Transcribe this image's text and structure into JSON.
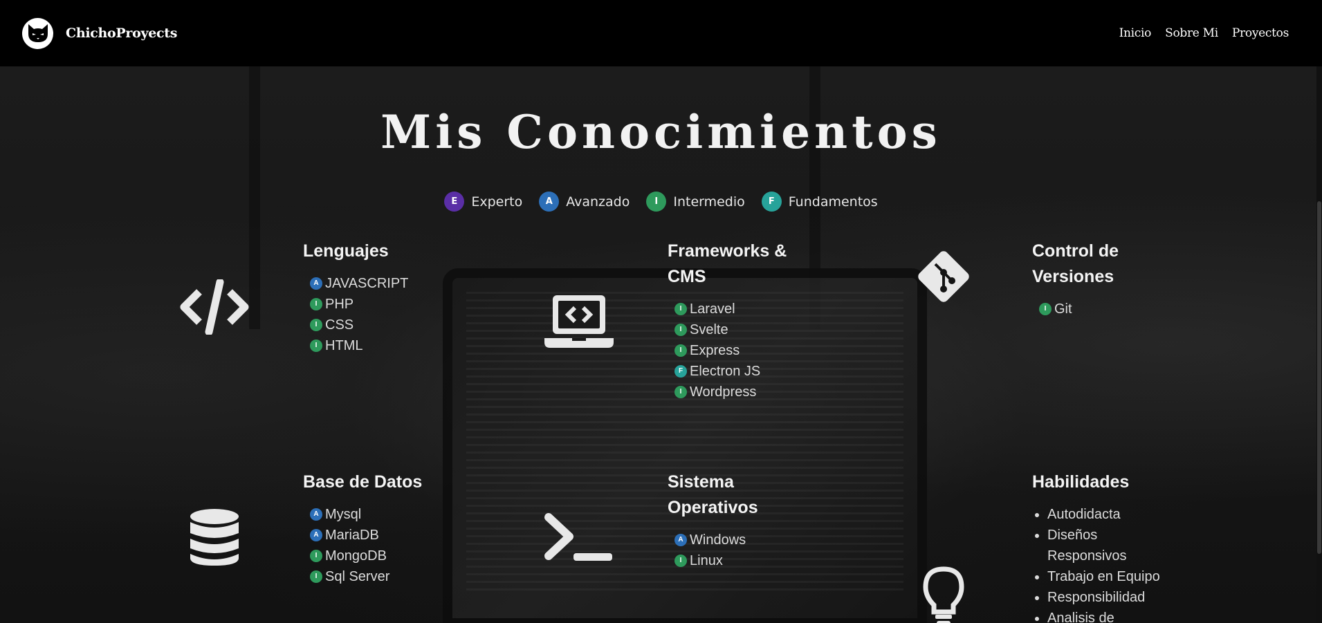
{
  "header": {
    "brand": "ChichoProyects",
    "nav": [
      "Inicio",
      "Sobre Mi",
      "Proyectos"
    ]
  },
  "title": "Mis Conocimientos",
  "legend": [
    {
      "code": "E",
      "label": "Experto",
      "color": "#5a2ea6"
    },
    {
      "code": "A",
      "label": "Avanzado",
      "color": "#2c6fb8"
    },
    {
      "code": "I",
      "label": "Intermedio",
      "color": "#2e9a5c"
    },
    {
      "code": "F",
      "label": "Fundamentos",
      "color": "#27a39a"
    }
  ],
  "categories": {
    "lenguajes": {
      "title": "Lenguajes",
      "icon": "code-icon",
      "items": [
        {
          "level": "A",
          "name": "JAVASCRIPT"
        },
        {
          "level": "I",
          "name": "PHP"
        },
        {
          "level": "I",
          "name": "CSS"
        },
        {
          "level": "I",
          "name": "HTML"
        }
      ]
    },
    "frameworks": {
      "title": "Frameworks & CMS",
      "icon": "laptop-code-icon",
      "items": [
        {
          "level": "I",
          "name": "Laravel"
        },
        {
          "level": "I",
          "name": "Svelte"
        },
        {
          "level": "I",
          "name": "Express"
        },
        {
          "level": "F",
          "name": "Electron JS"
        },
        {
          "level": "I",
          "name": "Wordpress"
        }
      ]
    },
    "versiones": {
      "title": "Control de Versiones",
      "icon": "git-icon",
      "items": [
        {
          "level": "I",
          "name": "Git"
        }
      ]
    },
    "basedatos": {
      "title": "Base de Datos",
      "icon": "database-icon",
      "items": [
        {
          "level": "A",
          "name": "Mysql"
        },
        {
          "level": "A",
          "name": "MariaDB"
        },
        {
          "level": "I",
          "name": "MongoDB"
        },
        {
          "level": "I",
          "name": "Sql Server"
        }
      ]
    },
    "sistemas": {
      "title": "Sistema Operativos",
      "icon": "terminal-icon",
      "items": [
        {
          "level": "A",
          "name": "Windows"
        },
        {
          "level": "I",
          "name": "Linux"
        }
      ]
    },
    "habilidades": {
      "title": "Habilidades",
      "icon": "lightbulb-icon",
      "items": [
        "Autodidacta",
        "Diseños Responsivos",
        "Trabajo en Equipo",
        "Responsibilidad",
        "Analisis de"
      ]
    }
  },
  "colors": {
    "header_bg": "#000000",
    "text": "#e8e8e8",
    "level_E": "#5a2ea6",
    "level_A": "#2c6fb8",
    "level_I": "#2e9a5c",
    "level_F": "#27a39a"
  }
}
